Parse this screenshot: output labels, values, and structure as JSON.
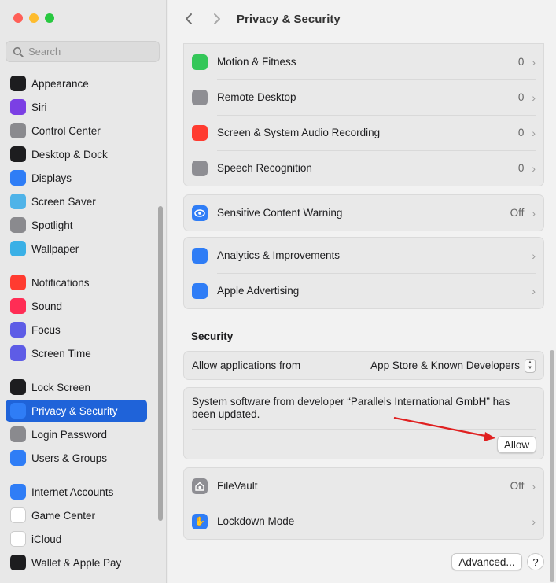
{
  "window": {
    "traffic_colors": [
      "#ff5f57",
      "#febc2e",
      "#28c840"
    ]
  },
  "search": {
    "placeholder": "Search"
  },
  "sidebar": {
    "items": [
      {
        "label": "Appearance",
        "icon": "appearance-icon",
        "color": "#1d1d1f"
      },
      {
        "label": "Siri",
        "icon": "siri-icon",
        "color": "#7b3fe4"
      },
      {
        "label": "Control Center",
        "icon": "control-center-icon",
        "color": "#8a8a8e"
      },
      {
        "label": "Desktop & Dock",
        "icon": "desktop-dock-icon",
        "color": "#1d1d1f"
      },
      {
        "label": "Displays",
        "icon": "displays-icon",
        "color": "#2f7df6"
      },
      {
        "label": "Screen Saver",
        "icon": "screen-saver-icon",
        "color": "#4fb3e8"
      },
      {
        "label": "Spotlight",
        "icon": "spotlight-icon",
        "color": "#8a8a8e"
      },
      {
        "label": "Wallpaper",
        "icon": "wallpaper-icon",
        "color": "#3ab0e6"
      },
      {
        "label": "Notifications",
        "icon": "notifications-icon",
        "color": "#ff3b30"
      },
      {
        "label": "Sound",
        "icon": "sound-icon",
        "color": "#ff2d55"
      },
      {
        "label": "Focus",
        "icon": "focus-icon",
        "color": "#5e5ce6"
      },
      {
        "label": "Screen Time",
        "icon": "screen-time-icon",
        "color": "#5e5ce6"
      },
      {
        "label": "Lock Screen",
        "icon": "lock-screen-icon",
        "color": "#1d1d1f"
      },
      {
        "label": "Privacy & Security",
        "icon": "privacy-hand-icon",
        "color": "#2f7df6",
        "active": true
      },
      {
        "label": "Login Password",
        "icon": "login-password-icon",
        "color": "#8a8a8e"
      },
      {
        "label": "Users & Groups",
        "icon": "users-groups-icon",
        "color": "#2f7df6"
      },
      {
        "label": "Internet Accounts",
        "icon": "internet-accounts-icon",
        "color": "#2f7df6"
      },
      {
        "label": "Game Center",
        "icon": "game-center-icon",
        "color": "#ffffff"
      },
      {
        "label": "iCloud",
        "icon": "icloud-icon",
        "color": "#ffffff"
      },
      {
        "label": "Wallet & Apple Pay",
        "icon": "wallet-icon",
        "color": "#1d1d1f"
      }
    ]
  },
  "header": {
    "title": "Privacy & Security"
  },
  "privacy_rows": [
    {
      "label": "Motion & Fitness",
      "value": "0",
      "icon": "motion-fitness-icon",
      "color": "#34c759"
    },
    {
      "label": "Remote Desktop",
      "value": "0",
      "icon": "binoculars-icon",
      "color": "#8e8e93"
    },
    {
      "label": "Screen & System Audio Recording",
      "value": "0",
      "icon": "record-icon",
      "color": "#ff3b30"
    },
    {
      "label": "Speech Recognition",
      "value": "0",
      "icon": "waveform-icon",
      "color": "#8e8e93"
    }
  ],
  "sensitive": {
    "label": "Sensitive Content Warning",
    "value": "Off",
    "icon": "eye-warning-icon",
    "color": "#2f7df6"
  },
  "analytics_rows": [
    {
      "label": "Analytics & Improvements",
      "icon": "analytics-icon",
      "color": "#2f7df6"
    },
    {
      "label": "Apple Advertising",
      "icon": "megaphone-icon",
      "color": "#2f7df6"
    }
  ],
  "security": {
    "title": "Security",
    "allow_label": "Allow applications from",
    "allow_value": "App Store & Known Developers",
    "notice": "System software from developer “Parallels International GmbH” has been updated.",
    "allow_button": "Allow"
  },
  "filevault": {
    "label": "FileVault",
    "value": "Off",
    "icon": "filevault-icon",
    "color": "#8e8e93"
  },
  "lockdown": {
    "label": "Lockdown Mode",
    "icon": "lockdown-hand-icon",
    "color": "#2f7df6"
  },
  "footer": {
    "advanced": "Advanced...",
    "help": "?"
  },
  "annotation": {
    "arrow_color": "#e02020"
  }
}
